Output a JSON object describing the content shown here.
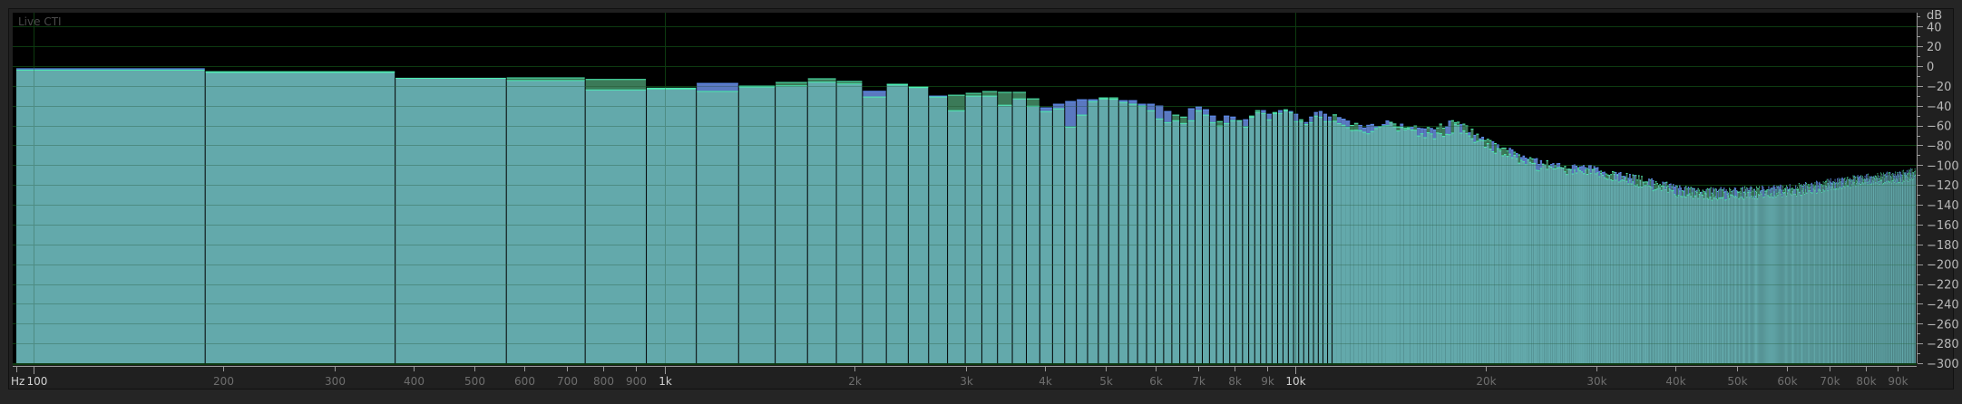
{
  "panel": {
    "overlay_label": "Live CTI"
  },
  "colors": {
    "background": "#252525",
    "plot_background": "#000000",
    "grid": "#0d3a10",
    "fill": "#63a9ab",
    "fill_top_line": "#4df0b4",
    "channel_green": "#3b7a58",
    "channel_blue": "#5a78c0",
    "blue_top_line": "#5b8cf0",
    "axis": "#9a9a9a"
  },
  "chart_data": {
    "type": "bar",
    "xscale": "log",
    "xlabel": "Hz",
    "ylabel": "dB",
    "xlim": [
      94,
      96000
    ],
    "ylim": [
      -300,
      54
    ],
    "grid": true,
    "bin_hz": 187.5,
    "bins": [
      {
        "fill": -3.5,
        "peak": -2.2,
        "ch": "blue"
      },
      {
        "fill": -5.8,
        "peak": -5.2,
        "ch": "green"
      },
      {
        "fill": -11.8,
        "peak": -11.4,
        "ch": "green"
      },
      {
        "fill": -14.0,
        "peak": -11.4,
        "ch": "green"
      },
      {
        "fill": -23.5,
        "peak": -13.0,
        "ch": "green"
      },
      {
        "fill": -22.5,
        "peak": -21.8,
        "ch": "green"
      },
      {
        "fill": -25.0,
        "peak": -17.0,
        "ch": "blue"
      },
      {
        "fill": -20.6,
        "peak": -19.7,
        "ch": "green"
      },
      {
        "fill": -19.4,
        "peak": -16.0,
        "ch": "green"
      },
      {
        "fill": -15.7,
        "peak": -12.3,
        "ch": "green"
      },
      {
        "fill": -17.5,
        "peak": -15.0,
        "ch": "green"
      },
      {
        "fill": -30.7,
        "peak": -25.0,
        "ch": "blue"
      },
      {
        "fill": -18.5,
        "peak": -17.8,
        "ch": "green"
      },
      {
        "fill": -21.2,
        "peak": -20.6,
        "ch": "green"
      },
      {
        "fill": -30.7,
        "peak": -29.8,
        "ch": "blue"
      },
      {
        "fill": -44.5,
        "peak": -28.9,
        "ch": "green"
      },
      {
        "fill": -29.8,
        "peak": -27.0,
        "ch": "green"
      },
      {
        "fill": -29.8,
        "peak": -25.2,
        "ch": "green"
      },
      {
        "fill": -39.0,
        "peak": -26.0,
        "ch": "green"
      },
      {
        "fill": -32.6,
        "peak": -26.0,
        "ch": "green"
      },
      {
        "fill": -40.0,
        "peak": -32.6,
        "ch": "green"
      },
      {
        "fill": -45.4,
        "peak": -41.7,
        "ch": "blue"
      },
      {
        "fill": -42.6,
        "peak": -38.0,
        "ch": "blue"
      },
      {
        "fill": -61.0,
        "peak": -35.3,
        "ch": "blue"
      },
      {
        "fill": -49.0,
        "peak": -33.5,
        "ch": "blue"
      },
      {
        "fill": -35.3,
        "peak": -33.5,
        "ch": "blue"
      },
      {
        "fill": -32.6,
        "peak": -31.6,
        "ch": "green"
      },
      {
        "fill": -33.0,
        "peak": -31.6,
        "ch": "green"
      },
      {
        "fill": -36.2,
        "peak": -34.4,
        "ch": "blue"
      },
      {
        "fill": -38.0,
        "peak": -34.4,
        "ch": "blue"
      },
      {
        "fill": -39.9,
        "peak": -38.0,
        "ch": "blue"
      },
      {
        "fill": -44.5,
        "peak": -38.0,
        "ch": "blue"
      },
      {
        "fill": -52.8,
        "peak": -39.9,
        "ch": "blue"
      },
      {
        "fill": -56.5,
        "peak": -45.4,
        "ch": "blue"
      },
      {
        "fill": -54.6,
        "peak": -49.0,
        "ch": "green"
      },
      {
        "fill": -57.4,
        "peak": -51.0,
        "ch": "green"
      },
      {
        "fill": -54.6,
        "peak": -42.6,
        "ch": "blue"
      },
      {
        "fill": -44.5,
        "peak": -40.8,
        "ch": "blue"
      },
      {
        "fill": -49.0,
        "peak": -43.6,
        "ch": "blue"
      },
      {
        "fill": -56.5,
        "peak": -50.0,
        "ch": "blue"
      },
      {
        "fill": -60.0,
        "peak": -55.5,
        "ch": "green"
      },
      {
        "fill": -57.4,
        "peak": -50.0,
        "ch": "blue"
      },
      {
        "fill": -54.6,
        "peak": -51.0,
        "ch": "blue"
      },
      {
        "fill": -54.6,
        "peak": -54.6,
        "ch": "green"
      },
      {
        "fill": -61.0,
        "peak": -53.7,
        "ch": "blue"
      },
      {
        "fill": -51.0,
        "peak": -50.0,
        "ch": "green"
      },
      {
        "fill": -46.4,
        "peak": -44.5,
        "ch": "green"
      },
      {
        "fill": -47.3,
        "peak": -44.5,
        "ch": "blue"
      },
      {
        "fill": -53.7,
        "peak": -48.2,
        "ch": "blue"
      },
      {
        "fill": -47.3,
        "peak": -46.4,
        "ch": "green"
      },
      {
        "fill": -47.3,
        "peak": -44.5,
        "ch": "blue"
      },
      {
        "fill": -44.5,
        "peak": -43.6,
        "ch": "green"
      },
      {
        "fill": -46.4,
        "peak": -45.4,
        "ch": "blue"
      },
      {
        "fill": -55.5,
        "peak": -48.2,
        "ch": "blue"
      },
      {
        "fill": -55.5,
        "peak": -53.7,
        "ch": "green"
      },
      {
        "fill": -58.4,
        "peak": -56.5,
        "ch": "blue"
      },
      {
        "fill": -56.5,
        "peak": -51.0,
        "ch": "blue"
      },
      {
        "fill": -50.0,
        "peak": -46.4,
        "ch": "blue"
      },
      {
        "fill": -51.0,
        "peak": -45.4,
        "ch": "blue"
      },
      {
        "fill": -55.5,
        "peak": -48.2,
        "ch": "blue"
      },
      {
        "fill": -55.5,
        "peak": -51.0,
        "ch": "blue"
      }
    ],
    "envelope": [
      [
        11500,
        -58,
        -51
      ],
      [
        12300,
        -61,
        -58
      ],
      [
        13200,
        -64,
        -61
      ],
      [
        14000,
        -58,
        -56
      ],
      [
        15600,
        -66,
        -63
      ],
      [
        17000,
        -70,
        -61
      ],
      [
        17900,
        -61,
        -55
      ],
      [
        20000,
        -79,
        -75
      ],
      [
        21500,
        -87,
        -84
      ],
      [
        23900,
        -100,
        -95
      ],
      [
        26400,
        -104,
        -101
      ],
      [
        29000,
        -104,
        -102
      ],
      [
        31500,
        -110,
        -107
      ],
      [
        32600,
        -112,
        -108
      ],
      [
        36000,
        -119,
        -115
      ],
      [
        40000,
        -127,
        -122
      ],
      [
        44800,
        -130,
        -125
      ],
      [
        49600,
        -130,
        -125
      ],
      [
        55000,
        -128,
        -123
      ],
      [
        61000,
        -127,
        -122
      ],
      [
        67000,
        -123,
        -118
      ],
      [
        74000,
        -118,
        -114
      ],
      [
        82000,
        -115,
        -111
      ],
      [
        91000,
        -113,
        -108
      ],
      [
        95000,
        -110,
        -105
      ]
    ],
    "y_ticks": [
      {
        "value": 40,
        "label": "40"
      },
      {
        "value": 20,
        "label": "20"
      },
      {
        "value": 0,
        "label": "0"
      },
      {
        "value": -20,
        "label": "−20"
      },
      {
        "value": -40,
        "label": "−40"
      },
      {
        "value": -60,
        "label": "−60"
      },
      {
        "value": -80,
        "label": "−80"
      },
      {
        "value": -100,
        "label": "−100"
      },
      {
        "value": -120,
        "label": "−120"
      },
      {
        "value": -140,
        "label": "−140"
      },
      {
        "value": -160,
        "label": "−160"
      },
      {
        "value": -180,
        "label": "−180"
      },
      {
        "value": -200,
        "label": "−200"
      },
      {
        "value": -220,
        "label": "−220"
      },
      {
        "value": -240,
        "label": "−240"
      },
      {
        "value": -260,
        "label": "−260"
      },
      {
        "value": -280,
        "label": "−280"
      },
      {
        "value": -300,
        "label": "−300"
      }
    ],
    "x_ticks": [
      {
        "value": 100,
        "label": "100",
        "major": true
      },
      {
        "value": 200,
        "label": "200"
      },
      {
        "value": 300,
        "label": "300"
      },
      {
        "value": 400,
        "label": "400"
      },
      {
        "value": 500,
        "label": "500"
      },
      {
        "value": 600,
        "label": "600"
      },
      {
        "value": 700,
        "label": "700"
      },
      {
        "value": 800,
        "label": "800"
      },
      {
        "value": 900,
        "label": "900"
      },
      {
        "value": 1000,
        "label": "1k",
        "major": true
      },
      {
        "value": 2000,
        "label": "2k"
      },
      {
        "value": 3000,
        "label": "3k"
      },
      {
        "value": 4000,
        "label": "4k"
      },
      {
        "value": 5000,
        "label": "5k"
      },
      {
        "value": 6000,
        "label": "6k"
      },
      {
        "value": 7000,
        "label": "7k"
      },
      {
        "value": 8000,
        "label": "8k"
      },
      {
        "value": 9000,
        "label": "9k"
      },
      {
        "value": 10000,
        "label": "10k",
        "major": true
      },
      {
        "value": 20000,
        "label": "20k"
      },
      {
        "value": 30000,
        "label": "30k"
      },
      {
        "value": 40000,
        "label": "40k"
      },
      {
        "value": 50000,
        "label": "50k"
      },
      {
        "value": 60000,
        "label": "60k"
      },
      {
        "value": 70000,
        "label": "70k"
      },
      {
        "value": 80000,
        "label": "80k"
      },
      {
        "value": 90000,
        "label": "90k"
      }
    ]
  }
}
